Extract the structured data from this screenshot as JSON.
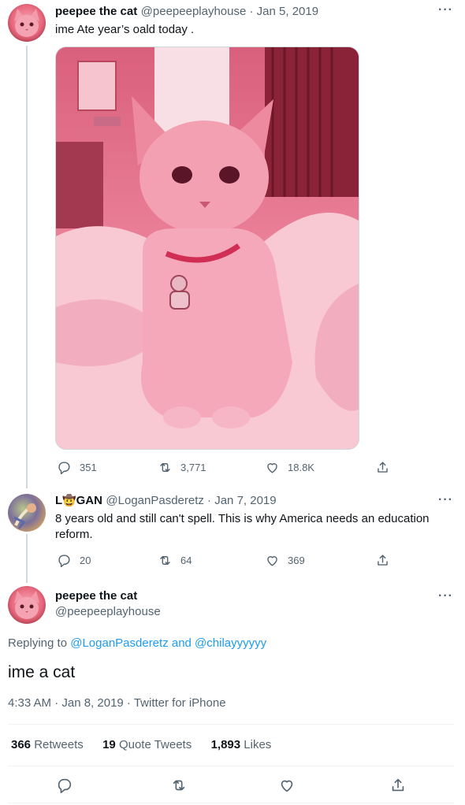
{
  "tweet1": {
    "display_name": "peepee the cat",
    "handle_date": "@peepeeplayhouse · Jan 5, 2019",
    "text": "ime Ate year’s oald today .",
    "replies": "351",
    "retweets": "3,771",
    "likes": "18.8K"
  },
  "tweet2": {
    "display_name_prefix": "L",
    "display_name_suffix": "GAN",
    "name_emoji": "🤠",
    "handle_date": "@LoganPasderetz · Jan 7, 2019",
    "text": "8 years old and still can't spell. This is why America needs an education reform.",
    "replies": "20",
    "retweets": "64",
    "likes": "369"
  },
  "main_tweet": {
    "display_name": "peepee the cat",
    "handle": "@peepeeplayhouse",
    "replying_label": "Replying to",
    "replying_to": "@LoganPasderetz and @chilayyyyyy",
    "text": "ime a cat",
    "timestamp": "4:33 AM · Jan 8, 2019 · Twitter for iPhone",
    "retweets_count": "366",
    "retweets_label": "Retweets",
    "quote_count": "19",
    "quote_label": "Quote Tweets",
    "likes_count": "1,893",
    "likes_label": "Likes"
  },
  "icons": {
    "reply": "reply-icon",
    "retweet": "retweet-icon",
    "like": "heart-icon",
    "share": "share-icon",
    "more": "more-icon"
  },
  "more_glyph": "···",
  "colors": {
    "link": "#1d9bf0",
    "secondary_text": "#536471",
    "thread_line": "#cfd9de"
  }
}
